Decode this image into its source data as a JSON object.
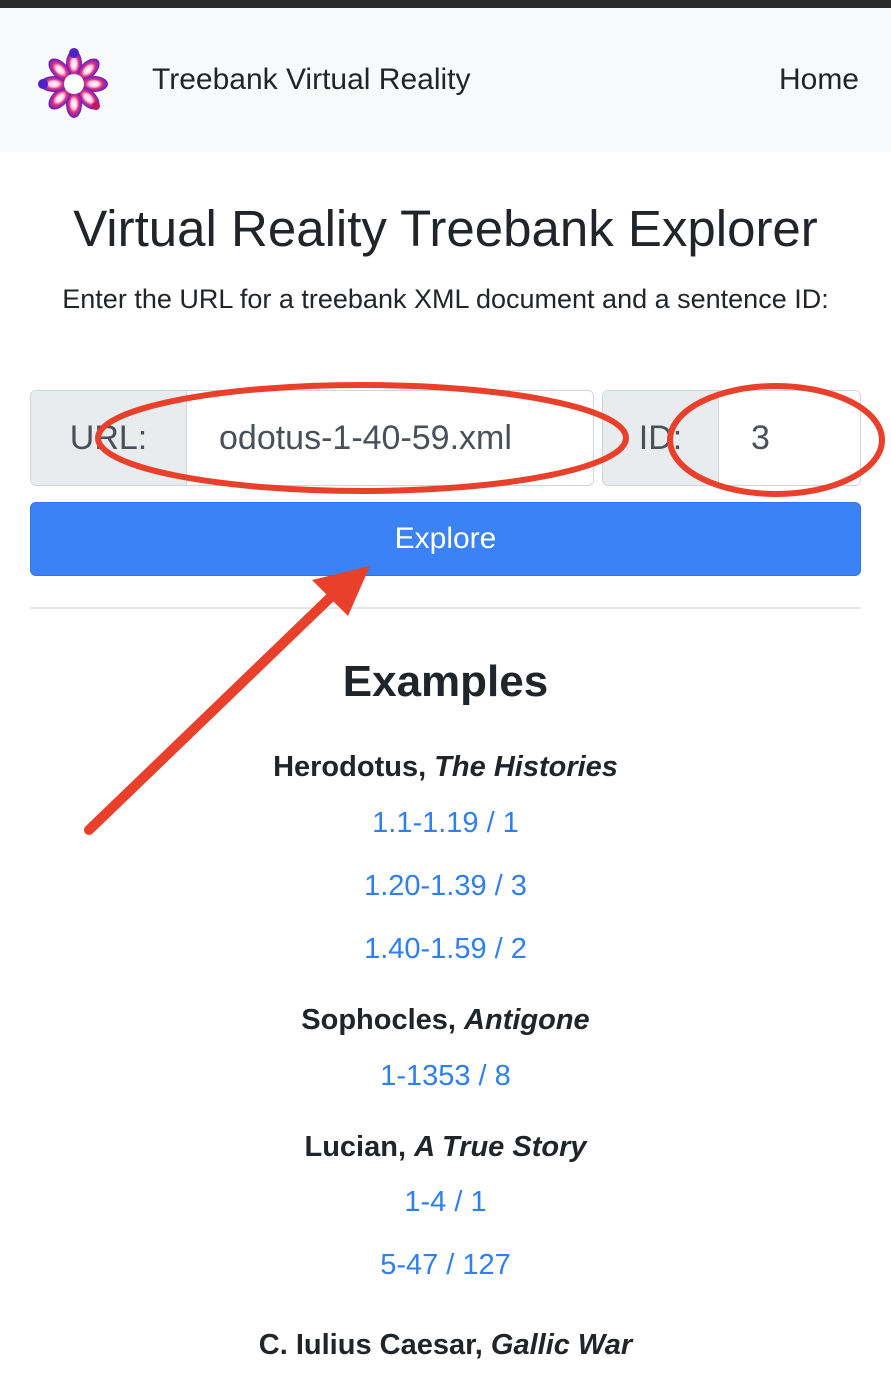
{
  "navbar": {
    "brand_name": "Treebank Virtual Reality",
    "home_label": "Home"
  },
  "page": {
    "title": "Virtual Reality Treebank Explorer",
    "intro": "Enter the URL for a treebank XML document and a sentence ID:"
  },
  "form": {
    "url_label": "URL:",
    "url_value": "odotus-1-40-59.xml",
    "id_label": "ID:",
    "id_value": "3",
    "submit_label": "Explore"
  },
  "examples": {
    "title": "Examples",
    "works": [
      {
        "author": "Herodotus,",
        "title": "The Histories",
        "links": [
          "1.1-1.19 / 1",
          "1.20-1.39 / 3",
          "1.40-1.59 / 2"
        ]
      },
      {
        "author": "Sophocles,",
        "title": "Antigone",
        "links": [
          "1-1353 / 8"
        ]
      },
      {
        "author": "Lucian,",
        "title": "A True Story",
        "links": [
          "1-4 / 1",
          "5-47 / 127"
        ]
      },
      {
        "author": "C. Iulius Caesar,",
        "title": "Gallic War",
        "links": []
      }
    ]
  },
  "colors": {
    "primary": "#3b82f6",
    "link": "#2f7ff0",
    "annotation": "#e8402a"
  }
}
